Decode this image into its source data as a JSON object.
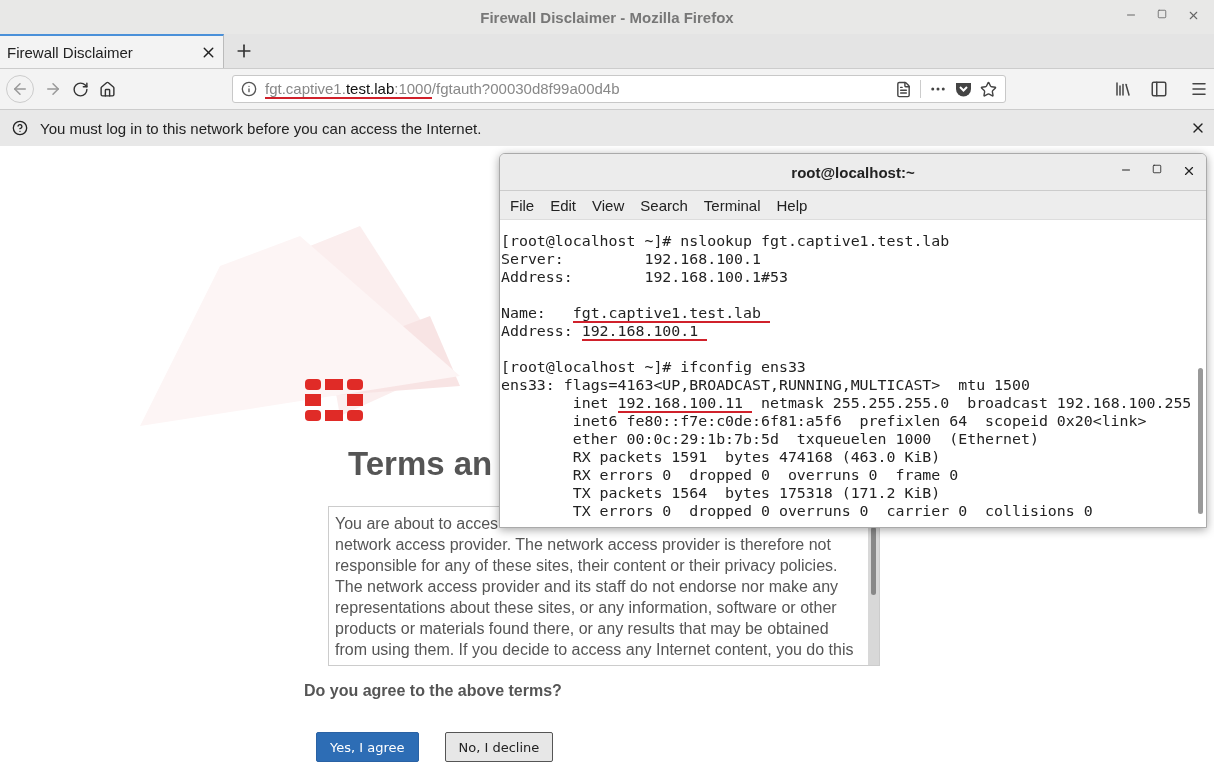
{
  "window": {
    "title": "Firewall Disclaimer - Mozilla Firefox"
  },
  "tabs": [
    {
      "label": "Firewall Disclaimer",
      "selected": true
    }
  ],
  "url": [
    {
      "text": "fgt.captive1.",
      "emphasis": false,
      "underlined": true
    },
    {
      "text": "test.lab",
      "emphasis": true,
      "underlined": true
    },
    {
      "text": ":1000",
      "emphasis": false,
      "underlined": true
    },
    {
      "text": "/fgtauth?00030d8f99a00d4b",
      "emphasis": false,
      "underlined": false
    }
  ],
  "notification": "You must log in to this network before you can access the Internet.",
  "page": {
    "heading": "Terms an",
    "disclaimer_start": "You are about to acces",
    "disclaimer": "network access provider. The network access provider is therefore not responsible for any of these sites, their content or their privacy policies. The network access provider and its staff do not endorse nor make any representations about these sites, or any information, software or other products or materials found there, or any results that may be obtained from using them. If you decide to access any Internet content, you do this",
    "question": "Do you agree to the above terms?",
    "buttons": [
      {
        "label": "Yes, I agree",
        "kind": "primary"
      },
      {
        "label": "No, I decline",
        "kind": "secondary"
      }
    ]
  },
  "terminal": {
    "title": "root@localhost:~",
    "menu": [
      "File",
      "Edit",
      "View",
      "Search",
      "Terminal",
      "Help"
    ],
    "lines": [
      [
        {
          "text": "[root@localhost ~]# nslookup fgt.captive1.test.lab",
          "underlined": false
        }
      ],
      [
        {
          "text": "Server:         192.168.100.1",
          "underlined": false
        }
      ],
      [
        {
          "text": "Address:        192.168.100.1#53",
          "underlined": false
        }
      ],
      [
        {
          "text": "Name:   ",
          "underlined": false
        },
        {
          "text": "fgt.captive1.test.lab ",
          "underlined": true
        }
      ],
      [
        {
          "text": "Address: ",
          "underlined": false
        },
        {
          "text": "192.168.100.1 ",
          "underlined": true
        }
      ],
      [
        {
          "text": "[root@localhost ~]# ifconfig ens33",
          "underlined": false
        }
      ],
      [
        {
          "text": "ens33: flags=4163<UP,BROADCAST,RUNNING,MULTICAST>  mtu 1500",
          "underlined": false
        }
      ],
      [
        {
          "text": "        inet ",
          "underlined": false
        },
        {
          "text": "192.168.100.11 ",
          "underlined": true
        },
        {
          "text": " netmask 255.255.255.0  broadcast 192.168.100.255",
          "underlined": false
        }
      ],
      [
        {
          "text": "        inet6 fe80::f7e:c0de:6f81:a5f6  prefixlen 64  scopeid 0x20<link>",
          "underlined": false
        }
      ],
      [
        {
          "text": "        ether 00:0c:29:1b:7b:5d  txqueuelen 1000  (Ethernet)",
          "underlined": false
        }
      ],
      [
        {
          "text": "        RX packets 1591  bytes 474168 (463.0 KiB)",
          "underlined": false
        }
      ],
      [
        {
          "text": "        RX errors 0  dropped 0  overruns 0  frame 0",
          "underlined": false
        }
      ],
      [
        {
          "text": "        TX packets 1564  bytes 175318 (171.2 KiB)",
          "underlined": false
        }
      ],
      [
        {
          "text": "        TX errors 0  dropped 0 overruns 0  carrier 0  collisions 0",
          "underlined": false
        }
      ]
    ]
  }
}
